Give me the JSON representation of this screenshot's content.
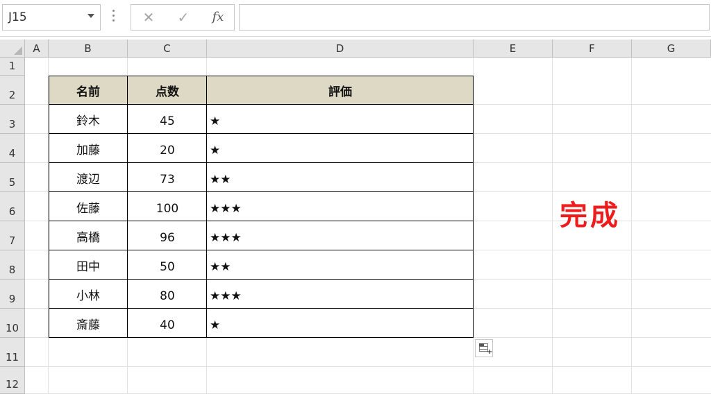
{
  "formula_bar": {
    "name_box": "J15",
    "cancel_icon": "✕",
    "enter_icon": "✓",
    "fx_label": "fx",
    "formula": ""
  },
  "columns": [
    "A",
    "B",
    "C",
    "D",
    "E",
    "F",
    "G"
  ],
  "rows": [
    "1",
    "2",
    "3",
    "4",
    "5",
    "6",
    "7",
    "8",
    "9",
    "10",
    "11",
    "12"
  ],
  "table": {
    "headers": [
      "名前",
      "点数",
      "評価"
    ],
    "rows": [
      {
        "name": "鈴木",
        "score": "45",
        "rating": "★"
      },
      {
        "name": "加藤",
        "score": "20",
        "rating": "★"
      },
      {
        "name": "渡辺",
        "score": "73",
        "rating": "★★"
      },
      {
        "name": "佐藤",
        "score": "100",
        "rating": "★★★"
      },
      {
        "name": "高橋",
        "score": "96",
        "rating": "★★★"
      },
      {
        "name": "田中",
        "score": "50",
        "rating": "★★"
      },
      {
        "name": "小林",
        "score": "80",
        "rating": "★★★"
      },
      {
        "name": "斎藤",
        "score": "40",
        "rating": "★"
      }
    ],
    "header_fill": "#ddd9c4"
  },
  "annotation": {
    "text": "完成",
    "color": "#ee1c1c"
  }
}
